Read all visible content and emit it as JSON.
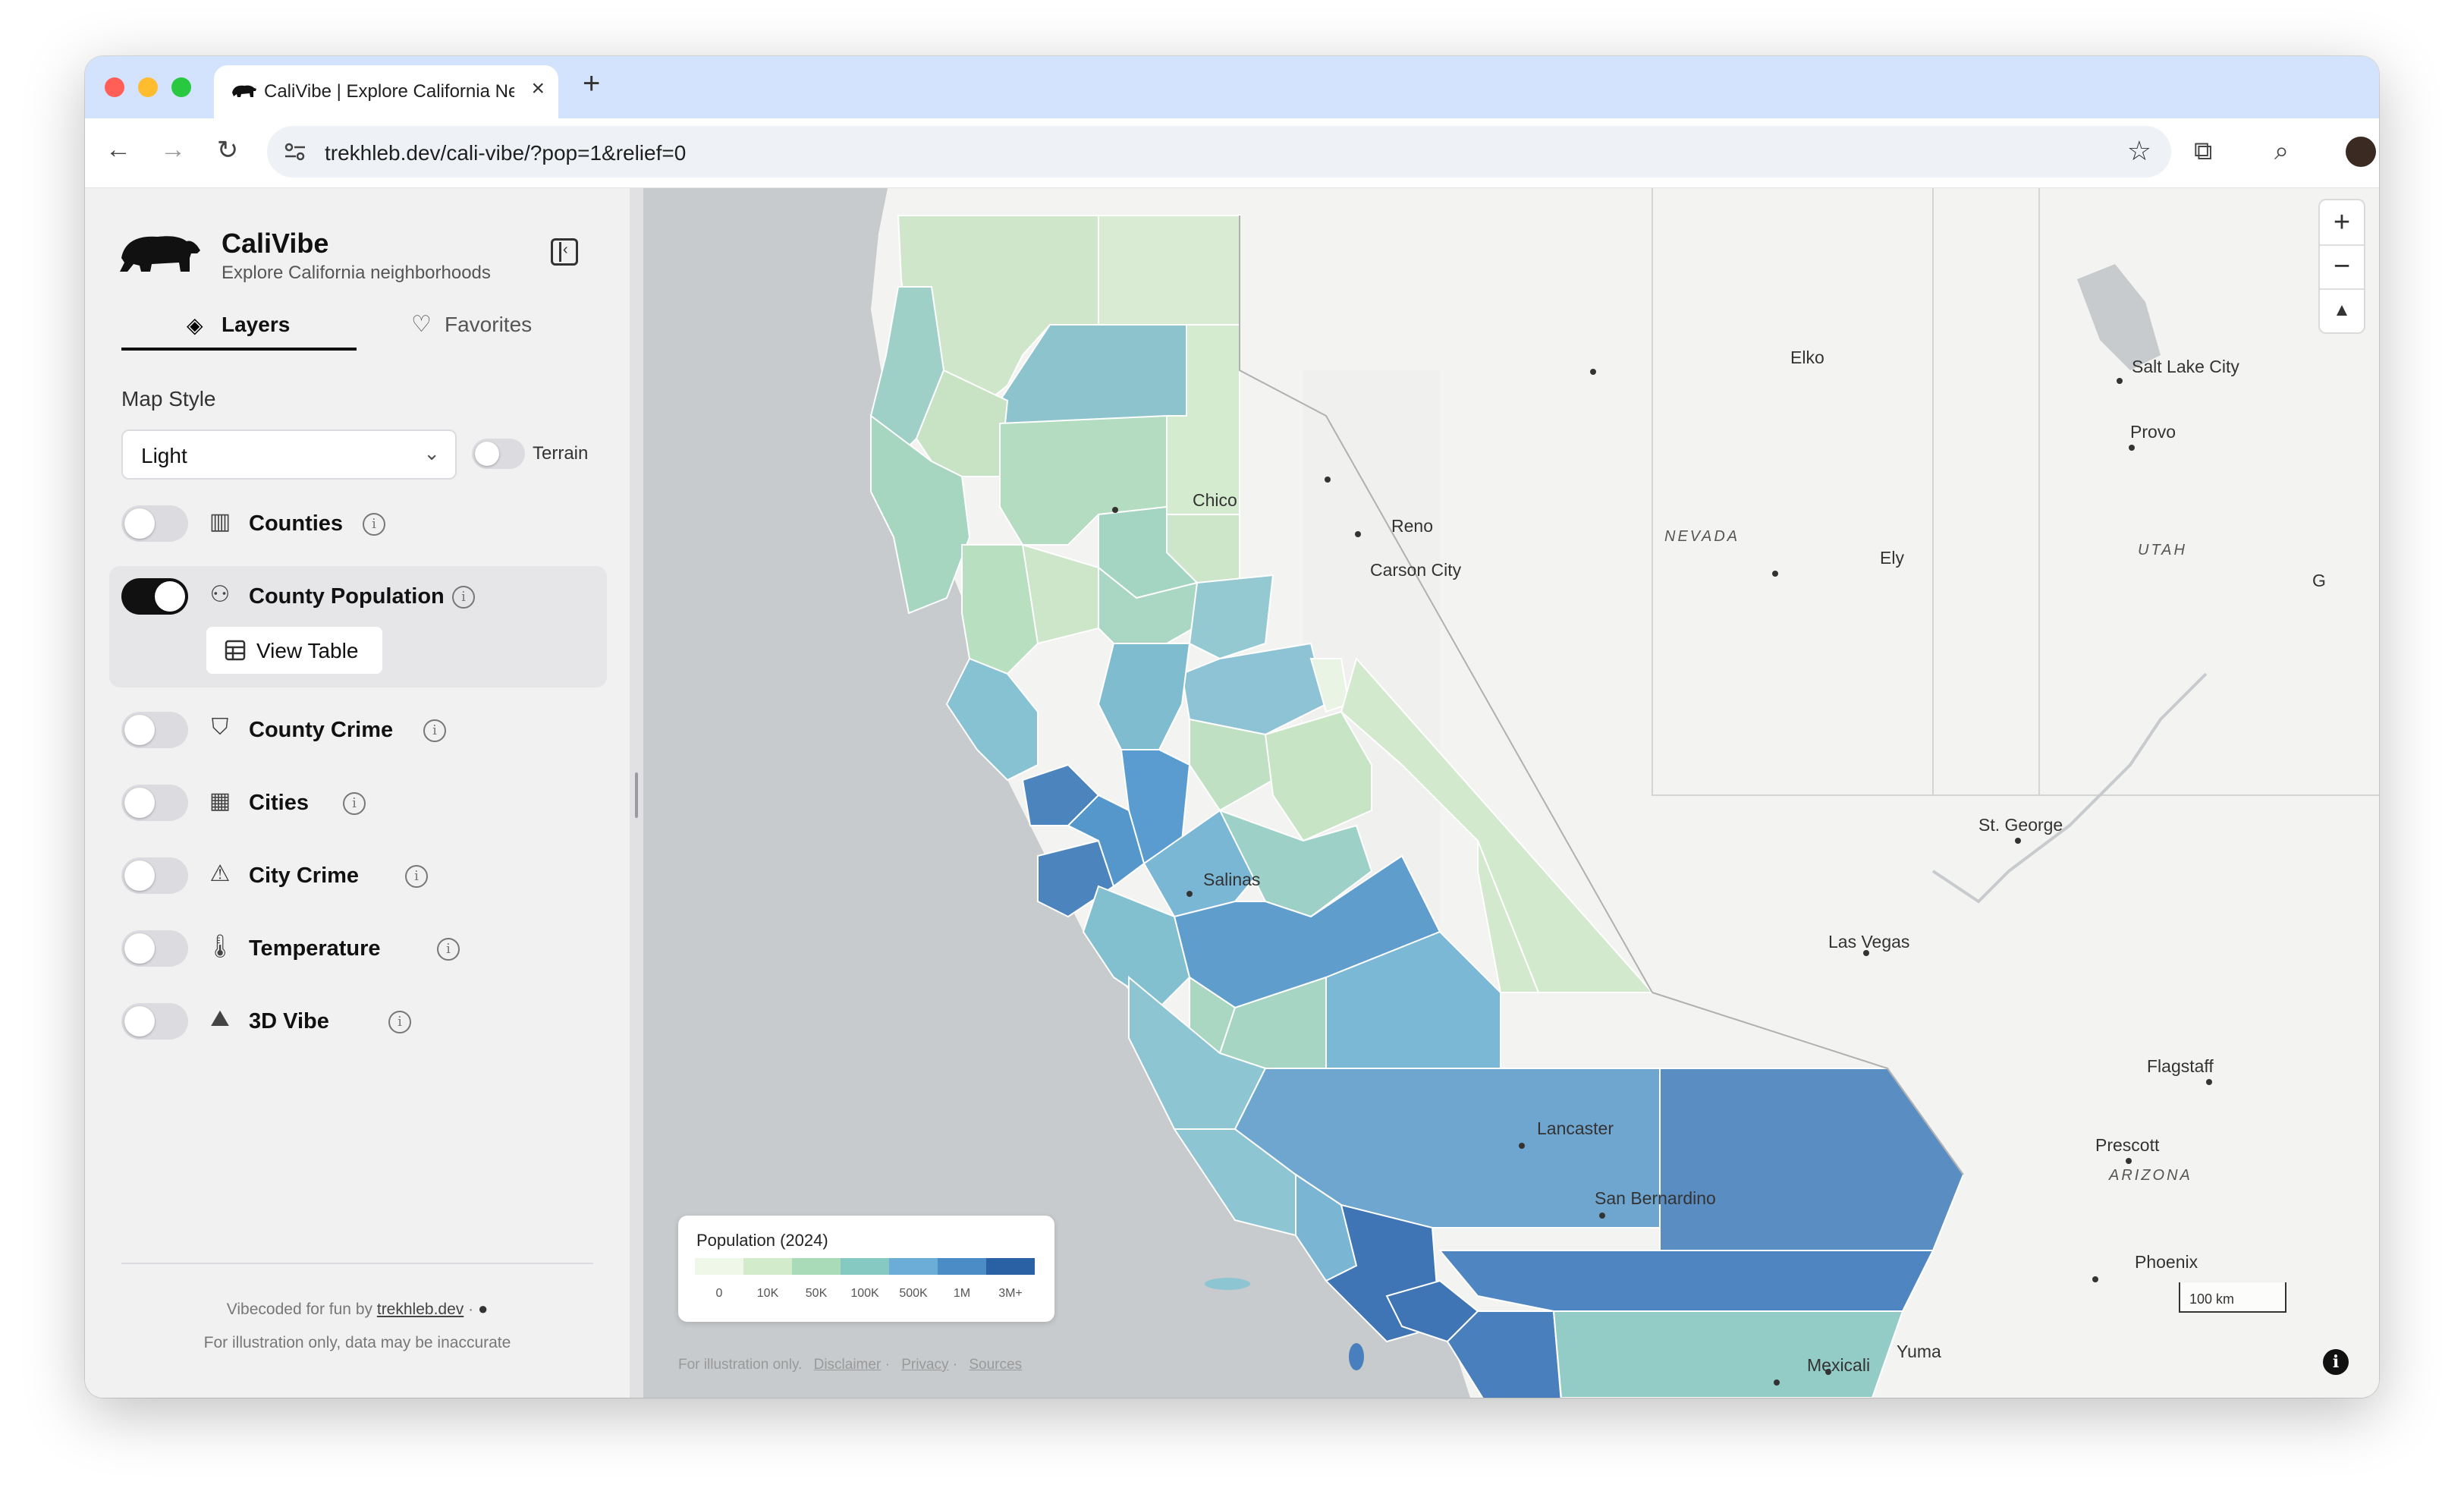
{
  "browser": {
    "tab_title": "CaliVibe | Explore California Neighborhoods",
    "url": "trekhleb.dev/cali-vibe/?pop=1&relief=0"
  },
  "app": {
    "title": "CaliVibe",
    "subtitle": "Explore California neighborhoods"
  },
  "tabs": {
    "layers": "Layers",
    "favorites": "Favorites"
  },
  "map_style": {
    "label": "Map Style",
    "value": "Light",
    "terrain_label": "Terrain",
    "terrain_on": false
  },
  "layers": [
    {
      "label": "Counties",
      "icon": "map-icon",
      "on": false
    },
    {
      "label": "County Population",
      "icon": "users-icon",
      "on": true
    },
    {
      "label": "County Crime",
      "icon": "shield-icon",
      "on": false
    },
    {
      "label": "Cities",
      "icon": "building-icon",
      "on": false
    },
    {
      "label": "City Crime",
      "icon": "siren-icon",
      "on": false
    },
    {
      "label": "Temperature",
      "icon": "thermometer-icon",
      "on": false
    },
    {
      "label": "3D Vibe",
      "icon": "mountain-icon",
      "on": false
    }
  ],
  "view_table_label": "View Table",
  "footer": {
    "line1_prefix": "Vibecoded for fun by",
    "line1_link": "trekhleb.dev",
    "line2": "For illustration only, data may be inaccurate"
  },
  "map": {
    "cities": [
      "Elko",
      "Salt Lake City",
      "Provo",
      "Reno",
      "Carson City",
      "Chico",
      "Ely",
      "St. George",
      "Las Vegas",
      "Salinas",
      "Flagstaff",
      "Prescott",
      "Lancaster",
      "San Bernardino",
      "Phoenix",
      "Mexicali",
      "Yuma",
      "G"
    ],
    "regions": [
      "NEVADA",
      "UTAH",
      "ARIZONA"
    ],
    "legend": {
      "title": "Population (2024)",
      "ticks": [
        "0",
        "10K",
        "50K",
        "100K",
        "500K",
        "1M",
        "3M+"
      ],
      "colors": [
        "#eff7e8",
        "#d2ebcb",
        "#a9dbb8",
        "#86c9c3",
        "#6badd6",
        "#4b8cc6",
        "#2a60a4"
      ]
    },
    "attribution": {
      "text": "For illustration only.",
      "links": [
        "Disclaimer",
        "Privacy",
        "Sources"
      ]
    },
    "scale_label": "100 km",
    "zoom_in": "+",
    "zoom_out": "−"
  }
}
